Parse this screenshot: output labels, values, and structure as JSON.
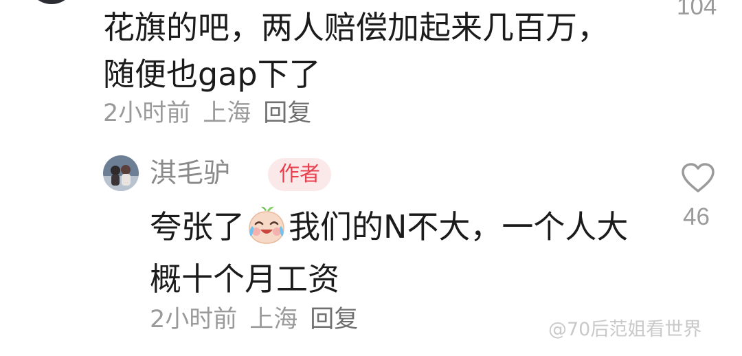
{
  "top_comment": {
    "text": "花旗的吧，两人赔偿加起来几百万，随便也gap下了",
    "time": "2小时前",
    "location": "上海",
    "reply_label": "回复",
    "like_count": "104"
  },
  "reply_comment": {
    "author_name": "淇毛驴",
    "author_badge": "作者",
    "text_before_emoji": "夸张了",
    "emoji": "laughing-crying-peach-emoji",
    "text_after_emoji": "我们的N不大，一个人大概十个月工资",
    "time": "2小时前",
    "location": "上海",
    "reply_label": "回复",
    "like_count": "46"
  },
  "watermark": "@70后范姐看世界",
  "colors": {
    "text_primary": "#1b1b1b",
    "text_secondary": "#9a9a9a",
    "badge_text": "#e8404e",
    "badge_bg": "#fbe9ea"
  }
}
